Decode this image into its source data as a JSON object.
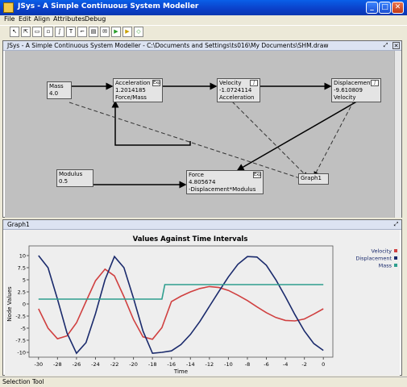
{
  "window": {
    "title": "JSys - A Simple Continuous System Modeller"
  },
  "menu": [
    "File",
    "Edit",
    "Align",
    "Attributes",
    "Debug"
  ],
  "toolbar": {
    "tools": [
      "cursor",
      "pointer",
      "rect",
      "var",
      "int",
      "text",
      "link",
      "graph",
      "play-green",
      "play-yellow",
      "stop"
    ]
  },
  "model_window": {
    "title": "JSys - A Simple Continuous System Modeller - C:\\Documents and Settings\\ts016\\My Documents\\SHM.draw",
    "nodes": [
      {
        "id": "mass",
        "name": "Mass",
        "value": "4.0",
        "expr": ""
      },
      {
        "id": "acceleration",
        "name": "Acceleration",
        "value": "1.2014185",
        "expr": "Force/Mass",
        "badge": "Exp"
      },
      {
        "id": "velocity",
        "name": "Velocity",
        "value": "-1.0724114",
        "expr": "Acceleration",
        "badge": "∫"
      },
      {
        "id": "displacement",
        "name": "Displacement",
        "value": "-9.610809",
        "expr": "Velocity",
        "badge": "∫"
      },
      {
        "id": "modulus",
        "name": "Modulus",
        "value": "0.5",
        "expr": ""
      },
      {
        "id": "force",
        "name": "Force",
        "value": "4.805674",
        "expr": "-Displacement*Modulus",
        "badge": "Exp"
      },
      {
        "id": "graph1",
        "name": "Graph1"
      }
    ]
  },
  "graph_window": {
    "title": "Graph1"
  },
  "status": {
    "text": "Selection Tool"
  },
  "chart_data": {
    "type": "line",
    "title": "Values Against Time Intervals",
    "xlabel": "Time",
    "ylabel": "Node Values",
    "xlim": [
      -31,
      1
    ],
    "ylim": [
      -11,
      11
    ],
    "xticks": [
      -30,
      -28,
      -26,
      -24,
      -22,
      -20,
      -18,
      -16,
      -14,
      -12,
      -10,
      -8,
      -6,
      -4,
      -2,
      0
    ],
    "yticks": [
      -10,
      -7.5,
      -5,
      -2.5,
      0,
      2.5,
      5,
      7.5,
      10
    ],
    "grid": false,
    "legend": "top-right",
    "series": [
      {
        "name": "Velocity",
        "color": "#d04040",
        "x": [
          -30,
          -29,
          -28,
          -27,
          -26,
          -25,
          -24,
          -23,
          -22,
          -21,
          -20,
          -19,
          -18,
          -17,
          -16,
          -15,
          -14,
          -13,
          -12,
          -11,
          -10,
          -9,
          -8,
          -7,
          -6,
          -5,
          -4,
          -3,
          -2,
          -1,
          0
        ],
        "y": [
          -1,
          -5,
          -7.2,
          -6.6,
          -3.9,
          0.5,
          4.8,
          7.2,
          5.8,
          1.5,
          -3.2,
          -6.8,
          -7.3,
          -4.9,
          0.5,
          1.6,
          2.5,
          3.2,
          3.6,
          3.4,
          2.8,
          1.8,
          0.7,
          -0.6,
          -1.8,
          -2.8,
          -3.4,
          -3.5,
          -3.1,
          -2.1,
          -1.0
        ]
      },
      {
        "name": "Displacement",
        "color": "#1a2a6c",
        "x": [
          -30,
          -29,
          -28,
          -27,
          -26,
          -25,
          -24,
          -23,
          -22,
          -21,
          -20,
          -19,
          -18,
          -17,
          -16,
          -15,
          -14,
          -13,
          -12,
          -11,
          -10,
          -9,
          -8,
          -7,
          -6,
          -5,
          -4,
          -3,
          -2,
          -1,
          0
        ],
        "y": [
          10,
          7.5,
          1,
          -6,
          -10.2,
          -8,
          -2,
          5,
          9.8,
          7.5,
          1.2,
          -5.6,
          -10.2,
          -10,
          -9.7,
          -8.4,
          -6.3,
          -3.6,
          -0.5,
          2.6,
          5.6,
          8.2,
          9.8,
          9.7,
          8,
          5,
          1.5,
          -2.2,
          -5.6,
          -8.2,
          -9.6
        ]
      },
      {
        "name": "Mass",
        "color": "#2e9e8e",
        "x": [
          -30,
          -17,
          -16.7,
          0
        ],
        "y": [
          1.0,
          1.0,
          4.0,
          4.0
        ]
      }
    ]
  }
}
